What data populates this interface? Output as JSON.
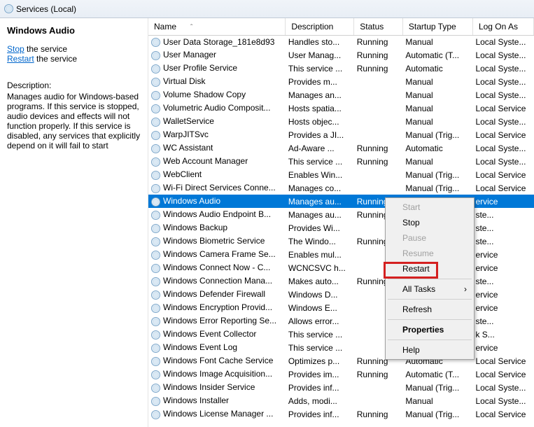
{
  "titlebar": {
    "text": "Services (Local)"
  },
  "left": {
    "title": "Windows Audio",
    "stop_link": "Stop",
    "stop_suffix": " the service",
    "restart_link": "Restart",
    "restart_suffix": " the service",
    "desc_label": "Description:",
    "desc_text": "Manages audio for Windows-based programs.  If this service is stopped, audio devices and effects will not function properly. If this service is disabled, any services that explicitly depend on it will fail to start"
  },
  "columns": {
    "name": "Name",
    "desc": "Description",
    "status": "Status",
    "startup": "Startup Type",
    "logon": "Log On As"
  },
  "rows": [
    {
      "name": "User Data Storage_181e8d93",
      "desc": "Handles sto...",
      "status": "Running",
      "startup": "Manual",
      "logon": "Local Syste..."
    },
    {
      "name": "User Manager",
      "desc": "User Manag...",
      "status": "Running",
      "startup": "Automatic (T...",
      "logon": "Local Syste..."
    },
    {
      "name": "User Profile Service",
      "desc": "This service ...",
      "status": "Running",
      "startup": "Automatic",
      "logon": "Local Syste..."
    },
    {
      "name": "Virtual Disk",
      "desc": "Provides m...",
      "status": "",
      "startup": "Manual",
      "logon": "Local Syste..."
    },
    {
      "name": "Volume Shadow Copy",
      "desc": "Manages an...",
      "status": "",
      "startup": "Manual",
      "logon": "Local Syste..."
    },
    {
      "name": "Volumetric Audio Composit...",
      "desc": "Hosts spatia...",
      "status": "",
      "startup": "Manual",
      "logon": "Local Service"
    },
    {
      "name": "WalletService",
      "desc": "Hosts objec...",
      "status": "",
      "startup": "Manual",
      "logon": "Local Syste..."
    },
    {
      "name": "WarpJITSvc",
      "desc": "Provides a JI...",
      "status": "",
      "startup": "Manual (Trig...",
      "logon": "Local Service"
    },
    {
      "name": "WC Assistant",
      "desc": "Ad-Aware ...",
      "status": "Running",
      "startup": "Automatic",
      "logon": "Local Syste..."
    },
    {
      "name": "Web Account Manager",
      "desc": "This service ...",
      "status": "Running",
      "startup": "Manual",
      "logon": "Local Syste..."
    },
    {
      "name": "WebClient",
      "desc": "Enables Win...",
      "status": "",
      "startup": "Manual (Trig...",
      "logon": "Local Service"
    },
    {
      "name": "Wi-Fi Direct Services Conne...",
      "desc": "Manages co...",
      "status": "",
      "startup": "Manual (Trig...",
      "logon": "Local Service"
    },
    {
      "name": "Windows Audio",
      "desc": "Manages au...",
      "status": "Running",
      "startup": "",
      "logon": "ervice",
      "selected": true
    },
    {
      "name": "Windows Audio Endpoint B...",
      "desc": "Manages au...",
      "status": "Running",
      "startup": "",
      "logon": "ste..."
    },
    {
      "name": "Windows Backup",
      "desc": "Provides Wi...",
      "status": "",
      "startup": "",
      "logon": "ste..."
    },
    {
      "name": "Windows Biometric Service",
      "desc": "The Windo...",
      "status": "Running",
      "startup": "",
      "logon": "ste..."
    },
    {
      "name": "Windows Camera Frame Se...",
      "desc": "Enables mul...",
      "status": "",
      "startup": "",
      "logon": "ervice"
    },
    {
      "name": "Windows Connect Now - C...",
      "desc": "WCNCSVC h...",
      "status": "",
      "startup": "",
      "logon": "ervice"
    },
    {
      "name": "Windows Connection Mana...",
      "desc": "Makes auto...",
      "status": "Running",
      "startup": "",
      "logon": "ste..."
    },
    {
      "name": "Windows Defender Firewall",
      "desc": "Windows D...",
      "status": "",
      "startup": "",
      "logon": "ervice"
    },
    {
      "name": "Windows Encryption Provid...",
      "desc": "Windows E...",
      "status": "",
      "startup": "",
      "logon": "ervice"
    },
    {
      "name": "Windows Error Reporting Se...",
      "desc": "Allows error...",
      "status": "",
      "startup": "",
      "logon": "ste..."
    },
    {
      "name": "Windows Event Collector",
      "desc": "This service ...",
      "status": "",
      "startup": "",
      "logon": "k S..."
    },
    {
      "name": "Windows Event Log",
      "desc": "This service ...",
      "status": "",
      "startup": "",
      "logon": "ervice"
    },
    {
      "name": "Windows Font Cache Service",
      "desc": "Optimizes p...",
      "status": "Running",
      "startup": "Automatic",
      "logon": "Local Service"
    },
    {
      "name": "Windows Image Acquisition...",
      "desc": "Provides im...",
      "status": "Running",
      "startup": "Automatic (T...",
      "logon": "Local Service"
    },
    {
      "name": "Windows Insider Service",
      "desc": "Provides inf...",
      "status": "",
      "startup": "Manual (Trig...",
      "logon": "Local Syste..."
    },
    {
      "name": "Windows Installer",
      "desc": "Adds, modi...",
      "status": "",
      "startup": "Manual",
      "logon": "Local Syste..."
    },
    {
      "name": "Windows License Manager ...",
      "desc": "Provides inf...",
      "status": "Running",
      "startup": "Manual (Trig...",
      "logon": "Local Service"
    }
  ],
  "ctx": {
    "start": "Start",
    "stop": "Stop",
    "pause": "Pause",
    "resume": "Resume",
    "restart": "Restart",
    "alltasks": "All Tasks",
    "refresh": "Refresh",
    "properties": "Properties",
    "help": "Help"
  }
}
